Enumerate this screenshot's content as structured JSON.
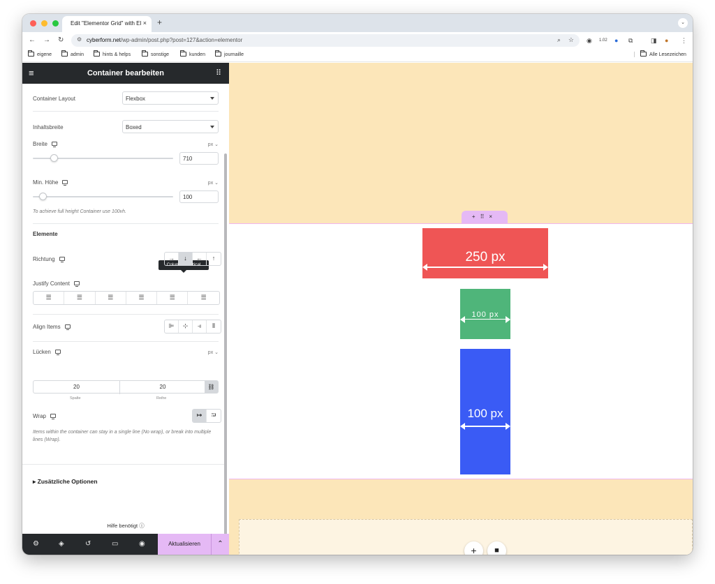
{
  "browser": {
    "tab_title": "Edit \"Elementor Grid\" with El",
    "tab_close": "×",
    "new_tab": "+",
    "url_domain": "cyberform.net",
    "url_path": "/wp-admin/post.php?post=127&action=elementor",
    "extension_badge": "1.02"
  },
  "bookmarks": {
    "items": [
      "eigene",
      "admin",
      "hints & helps",
      "sonstige",
      "kunden",
      "journaille"
    ],
    "all": "Alle Lesezeichen"
  },
  "panel": {
    "title": "Container bearbeiten",
    "container_layout_label": "Container Layout",
    "container_layout_value": "Flexbox",
    "content_width_label": "Inhaltsbreite",
    "content_width_value": "Boxed",
    "width_label": "Breite",
    "width_unit": "px ⌄",
    "width_value": "710",
    "width_slider_fraction": 0.15,
    "min_height_label": "Min. Höhe",
    "min_height_unit": "px ⌄",
    "min_height_value": "100",
    "min_height_slider_fraction": 0.07,
    "min_height_hint": "To achieve full height Container use 100vh.",
    "elements_section": "Elemente",
    "direction_label": "Richtung",
    "direction_tooltip": "Column - vertical",
    "direction_options": [
      "→",
      "↓",
      "←",
      "↑"
    ],
    "direction_active_index": 1,
    "justify_label": "Justify Content",
    "justify_options": [
      "☰",
      "☰",
      "☰",
      "☰",
      "☰",
      "☰"
    ],
    "align_label": "Align Items",
    "align_options": [
      "⊫",
      "⊹",
      "⫣",
      "⫴"
    ],
    "gaps_label": "Lücken",
    "gaps_unit": "px ⌄",
    "gap_column_value": "20",
    "gap_row_value": "20",
    "gap_column_label": "Spalte",
    "gap_row_label": "Reihe",
    "wrap_label": "Wrap",
    "wrap_hint": "Items within the container can stay in a single line (No wrap), or break into multiple lines (Wrap).",
    "extra_options": "Zusätzliche Optionen",
    "help": "Hilfe benötigt",
    "update_button": "Aktualisieren"
  },
  "canvas": {
    "red_box_label": "250 px",
    "green_box_label": "100 px",
    "blue_box_label": "100 px",
    "handle_icons": [
      "+",
      "⠿",
      "×"
    ]
  },
  "colors": {
    "panel_dark": "#26292c",
    "accent_pink": "#e5b9f5",
    "canvas_bg": "#fce6b9",
    "red_box": "#ef5555",
    "green_box": "#4fb57a",
    "blue_box": "#3a5bf5"
  }
}
